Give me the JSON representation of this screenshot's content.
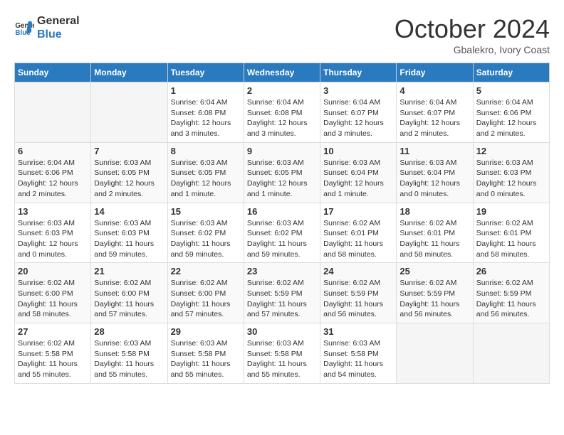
{
  "header": {
    "logo_line1": "General",
    "logo_line2": "Blue",
    "month": "October 2024",
    "location": "Gbalekro, Ivory Coast"
  },
  "weekdays": [
    "Sunday",
    "Monday",
    "Tuesday",
    "Wednesday",
    "Thursday",
    "Friday",
    "Saturday"
  ],
  "weeks": [
    [
      {
        "day": "",
        "empty": true
      },
      {
        "day": "",
        "empty": true
      },
      {
        "day": "1",
        "sunrise": "Sunrise: 6:04 AM",
        "sunset": "Sunset: 6:08 PM",
        "daylight": "Daylight: 12 hours and 3 minutes."
      },
      {
        "day": "2",
        "sunrise": "Sunrise: 6:04 AM",
        "sunset": "Sunset: 6:08 PM",
        "daylight": "Daylight: 12 hours and 3 minutes."
      },
      {
        "day": "3",
        "sunrise": "Sunrise: 6:04 AM",
        "sunset": "Sunset: 6:07 PM",
        "daylight": "Daylight: 12 hours and 3 minutes."
      },
      {
        "day": "4",
        "sunrise": "Sunrise: 6:04 AM",
        "sunset": "Sunset: 6:07 PM",
        "daylight": "Daylight: 12 hours and 2 minutes."
      },
      {
        "day": "5",
        "sunrise": "Sunrise: 6:04 AM",
        "sunset": "Sunset: 6:06 PM",
        "daylight": "Daylight: 12 hours and 2 minutes."
      }
    ],
    [
      {
        "day": "6",
        "sunrise": "Sunrise: 6:04 AM",
        "sunset": "Sunset: 6:06 PM",
        "daylight": "Daylight: 12 hours and 2 minutes."
      },
      {
        "day": "7",
        "sunrise": "Sunrise: 6:03 AM",
        "sunset": "Sunset: 6:05 PM",
        "daylight": "Daylight: 12 hours and 2 minutes."
      },
      {
        "day": "8",
        "sunrise": "Sunrise: 6:03 AM",
        "sunset": "Sunset: 6:05 PM",
        "daylight": "Daylight: 12 hours and 1 minute."
      },
      {
        "day": "9",
        "sunrise": "Sunrise: 6:03 AM",
        "sunset": "Sunset: 6:05 PM",
        "daylight": "Daylight: 12 hours and 1 minute."
      },
      {
        "day": "10",
        "sunrise": "Sunrise: 6:03 AM",
        "sunset": "Sunset: 6:04 PM",
        "daylight": "Daylight: 12 hours and 1 minute."
      },
      {
        "day": "11",
        "sunrise": "Sunrise: 6:03 AM",
        "sunset": "Sunset: 6:04 PM",
        "daylight": "Daylight: 12 hours and 0 minutes."
      },
      {
        "day": "12",
        "sunrise": "Sunrise: 6:03 AM",
        "sunset": "Sunset: 6:03 PM",
        "daylight": "Daylight: 12 hours and 0 minutes."
      }
    ],
    [
      {
        "day": "13",
        "sunrise": "Sunrise: 6:03 AM",
        "sunset": "Sunset: 6:03 PM",
        "daylight": "Daylight: 12 hours and 0 minutes."
      },
      {
        "day": "14",
        "sunrise": "Sunrise: 6:03 AM",
        "sunset": "Sunset: 6:03 PM",
        "daylight": "Daylight: 11 hours and 59 minutes."
      },
      {
        "day": "15",
        "sunrise": "Sunrise: 6:03 AM",
        "sunset": "Sunset: 6:02 PM",
        "daylight": "Daylight: 11 hours and 59 minutes."
      },
      {
        "day": "16",
        "sunrise": "Sunrise: 6:03 AM",
        "sunset": "Sunset: 6:02 PM",
        "daylight": "Daylight: 11 hours and 59 minutes."
      },
      {
        "day": "17",
        "sunrise": "Sunrise: 6:02 AM",
        "sunset": "Sunset: 6:01 PM",
        "daylight": "Daylight: 11 hours and 58 minutes."
      },
      {
        "day": "18",
        "sunrise": "Sunrise: 6:02 AM",
        "sunset": "Sunset: 6:01 PM",
        "daylight": "Daylight: 11 hours and 58 minutes."
      },
      {
        "day": "19",
        "sunrise": "Sunrise: 6:02 AM",
        "sunset": "Sunset: 6:01 PM",
        "daylight": "Daylight: 11 hours and 58 minutes."
      }
    ],
    [
      {
        "day": "20",
        "sunrise": "Sunrise: 6:02 AM",
        "sunset": "Sunset: 6:00 PM",
        "daylight": "Daylight: 11 hours and 58 minutes."
      },
      {
        "day": "21",
        "sunrise": "Sunrise: 6:02 AM",
        "sunset": "Sunset: 6:00 PM",
        "daylight": "Daylight: 11 hours and 57 minutes."
      },
      {
        "day": "22",
        "sunrise": "Sunrise: 6:02 AM",
        "sunset": "Sunset: 6:00 PM",
        "daylight": "Daylight: 11 hours and 57 minutes."
      },
      {
        "day": "23",
        "sunrise": "Sunrise: 6:02 AM",
        "sunset": "Sunset: 5:59 PM",
        "daylight": "Daylight: 11 hours and 57 minutes."
      },
      {
        "day": "24",
        "sunrise": "Sunrise: 6:02 AM",
        "sunset": "Sunset: 5:59 PM",
        "daylight": "Daylight: 11 hours and 56 minutes."
      },
      {
        "day": "25",
        "sunrise": "Sunrise: 6:02 AM",
        "sunset": "Sunset: 5:59 PM",
        "daylight": "Daylight: 11 hours and 56 minutes."
      },
      {
        "day": "26",
        "sunrise": "Sunrise: 6:02 AM",
        "sunset": "Sunset: 5:59 PM",
        "daylight": "Daylight: 11 hours and 56 minutes."
      }
    ],
    [
      {
        "day": "27",
        "sunrise": "Sunrise: 6:02 AM",
        "sunset": "Sunset: 5:58 PM",
        "daylight": "Daylight: 11 hours and 55 minutes."
      },
      {
        "day": "28",
        "sunrise": "Sunrise: 6:03 AM",
        "sunset": "Sunset: 5:58 PM",
        "daylight": "Daylight: 11 hours and 55 minutes."
      },
      {
        "day": "29",
        "sunrise": "Sunrise: 6:03 AM",
        "sunset": "Sunset: 5:58 PM",
        "daylight": "Daylight: 11 hours and 55 minutes."
      },
      {
        "day": "30",
        "sunrise": "Sunrise: 6:03 AM",
        "sunset": "Sunset: 5:58 PM",
        "daylight": "Daylight: 11 hours and 55 minutes."
      },
      {
        "day": "31",
        "sunrise": "Sunrise: 6:03 AM",
        "sunset": "Sunset: 5:58 PM",
        "daylight": "Daylight: 11 hours and 54 minutes."
      },
      {
        "day": "",
        "empty": true
      },
      {
        "day": "",
        "empty": true
      }
    ]
  ]
}
